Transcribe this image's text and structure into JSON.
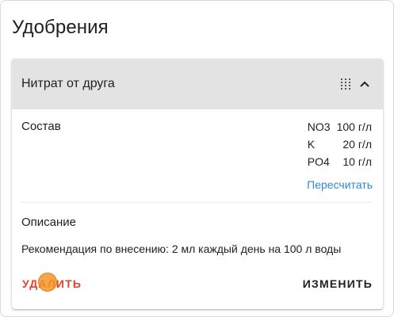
{
  "page": {
    "title": "Удобрения"
  },
  "fertilizer": {
    "name": "Нитрат от друга",
    "icons": {
      "drag": "drag-handle-icon",
      "collapse": "chevron-up-icon"
    },
    "composition_label": "Состав",
    "composition": [
      {
        "element": "NO3",
        "value": "100 г/л"
      },
      {
        "element": "K",
        "value": "20 г/л"
      },
      {
        "element": "PO4",
        "value": "10 г/л"
      }
    ],
    "recalculate_label": "Пересчитать",
    "description_label": "Описание",
    "description": "Рекомендация по внесению: 2 мл каждый день на 100 л воды",
    "delete_label": "УДАЛИТЬ",
    "edit_label": "ИЗМЕНИТЬ"
  },
  "colors": {
    "header_bg": "#e3e3e3",
    "link": "#2f86d6",
    "danger": "#e0442c",
    "cursor_marker": "#f59628"
  }
}
